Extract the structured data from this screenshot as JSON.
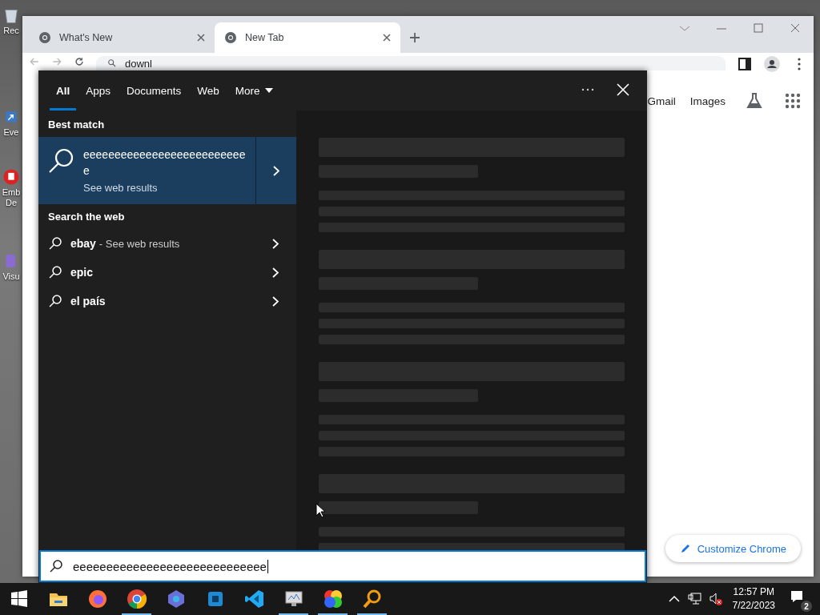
{
  "desktop_icons": [
    {
      "label": "Rec",
      "kind": "bin"
    },
    {
      "label": "Eve",
      "kind": "shortcut"
    },
    {
      "label": "Emb De",
      "kind": "red"
    },
    {
      "label": "Visu",
      "kind": "purple"
    }
  ],
  "browser": {
    "tabs": [
      {
        "title": "What's New",
        "selected": false
      },
      {
        "title": "New Tab",
        "selected": true
      }
    ],
    "address": "downl",
    "links": [
      "Gmail",
      "Images"
    ],
    "customize": "Customize Chrome"
  },
  "search_panel": {
    "filters": [
      {
        "label": "All",
        "selected": true,
        "kind": "plain"
      },
      {
        "label": "Apps",
        "selected": false,
        "kind": "plain"
      },
      {
        "label": "Documents",
        "selected": false,
        "kind": "plain"
      },
      {
        "label": "Web",
        "selected": false,
        "kind": "plain"
      },
      {
        "label": "More",
        "selected": false,
        "kind": "menu"
      }
    ],
    "best_match_heading": "Best match",
    "best_match": {
      "title": "eeeeeeeeeeeeeeeeeeeeeeeeeee",
      "subtitle": "See web results",
      "selected": true
    },
    "web_heading": "Search the web",
    "suggestions": [
      {
        "term": "ebay",
        "hint": "- See web results"
      },
      {
        "term": "epic"
      },
      {
        "term": "el país"
      }
    ],
    "query": "eeeeeeeeeeeeeeeeeeeeeeeeeeeee"
  },
  "taskbar": {
    "apps": [
      {
        "kind": "folder",
        "running": false
      },
      {
        "kind": "firefox",
        "running": false
      },
      {
        "kind": "chrome",
        "running": true
      },
      {
        "kind": "swirl",
        "running": false
      },
      {
        "kind": "tool",
        "running": false
      },
      {
        "kind": "code",
        "running": false
      },
      {
        "kind": "monitor",
        "running": true
      },
      {
        "kind": "wheel",
        "running": true
      },
      {
        "kind": "magnifier",
        "running": true
      }
    ],
    "time": "12:57 PM",
    "date": "7/22/2023",
    "notifications": "2"
  }
}
